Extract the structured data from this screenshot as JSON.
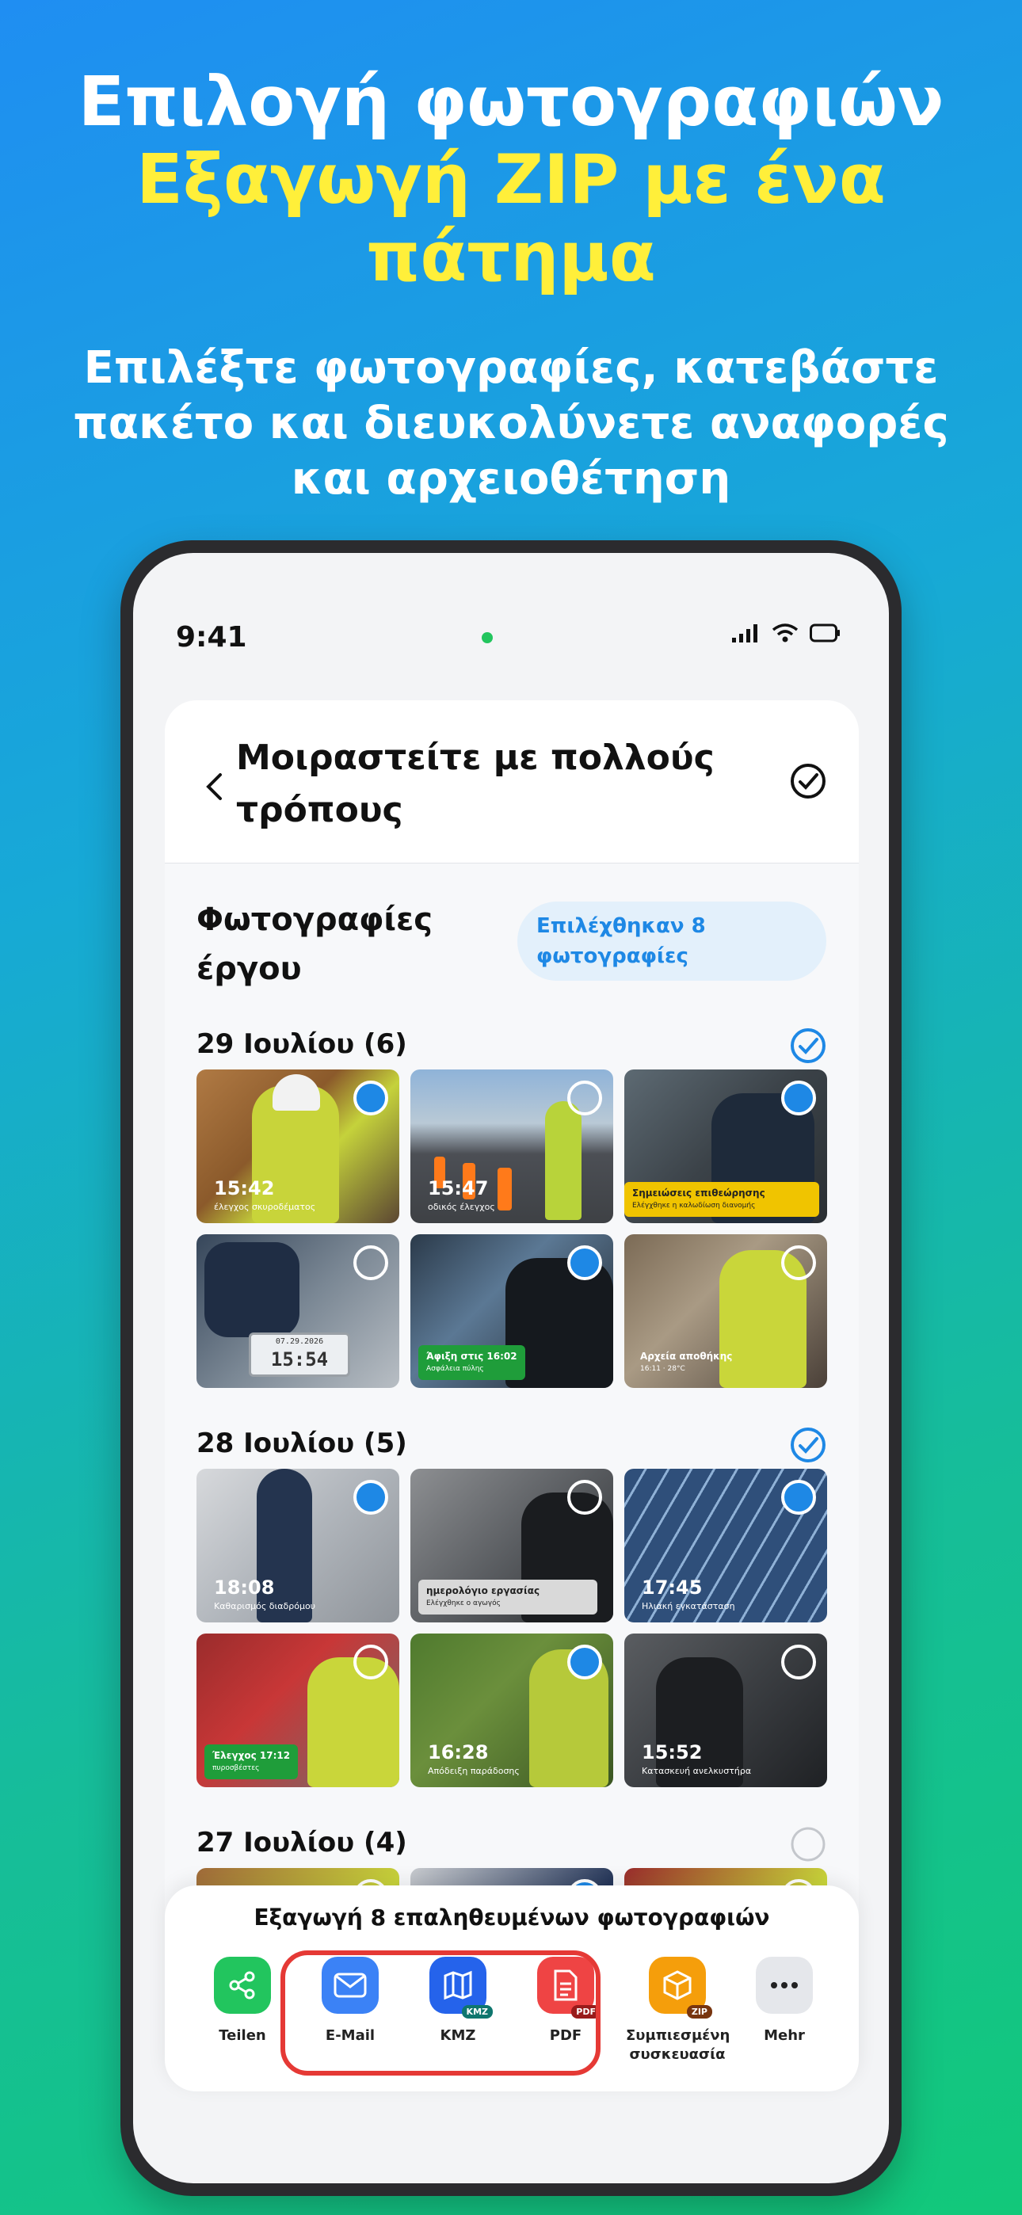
{
  "headline": {
    "line1": "Επιλογή φωτογραφιών",
    "line2": "Εξαγωγή ZIP με ένα",
    "line3": "πάτημα"
  },
  "subhead": {
    "line1": "Επιλέξτε φωτογραφίες, κατεβάστε",
    "line2": "πακέτο και διευκολύνετε αναφορές",
    "line3": "και αρχειοθέτηση"
  },
  "status_bar": {
    "time": "9:41"
  },
  "topbar": {
    "title": "Μοιραστείτε με πολλούς τρόπους"
  },
  "section": {
    "title": "Φωτογραφίες έργου",
    "selected_badge": "Επιλέχθηκαν 8 φωτογραφίες"
  },
  "groups": [
    {
      "date": "29 Ιουλίου (6)",
      "all_checked": true,
      "photos": [
        {
          "selected": true,
          "time": "15:42",
          "caption": "έλεγχος σκυροδέματος"
        },
        {
          "selected": false,
          "time": "15:47",
          "caption": "οδικός έλεγχος"
        },
        {
          "selected": true,
          "note_title": "Σημειώσεις επιθεώρησης",
          "note_sub": "Ελέγχθηκε η καλωδίωση διανομής"
        },
        {
          "selected": false,
          "clock_date": "07.29.2026",
          "clock_time": "15:54"
        },
        {
          "selected": true,
          "note_title": "Άφιξη στις 16:02",
          "note_sub": "Ασφάλεια πύλης"
        },
        {
          "selected": false,
          "note_title": "Αρχεία αποθήκης",
          "note_sub": "16:11 · 28°C"
        }
      ]
    },
    {
      "date": "28 Ιουλίου (5)",
      "all_checked": true,
      "photos": [
        {
          "selected": true,
          "time": "18:08",
          "caption": "Καθαρισμός διαδρόμου"
        },
        {
          "selected": false,
          "note_title": "ημερολόγιο εργασίας",
          "note_sub": "Ελέγχθηκε ο αγωγός"
        },
        {
          "selected": true,
          "time": "17:45",
          "caption": "Ηλιακή εγκατάσταση"
        },
        {
          "selected": false,
          "note_title": "Έλεγχος 17:12",
          "note_sub": "πυροσβέστες"
        },
        {
          "selected": true,
          "time": "16:28",
          "caption": "Απόδειξη παράδοσης"
        },
        {
          "selected": false,
          "time": "15:52",
          "caption": "Κατασκευή ανελκυστήρα"
        }
      ]
    },
    {
      "date": "27 Ιουλίου (4)",
      "all_checked": false
    }
  ],
  "export": {
    "title": "Εξαγωγή 8 επαληθευμένων φωτογραφιών",
    "buttons": [
      {
        "label": "Teilen",
        "color": "#22c55e"
      },
      {
        "label": "E-Mail",
        "color": "#3b82f6"
      },
      {
        "label": "KMZ",
        "tag": "KMZ",
        "color": "#2563eb"
      },
      {
        "label": "PDF",
        "tag": "PDF",
        "color": "#ef4444"
      },
      {
        "label": "Συμπιεσμένη συσκευασία",
        "tag": "ZIP",
        "color": "#f59e0b"
      },
      {
        "label": "Mehr",
        "color": "#e5e7eb"
      }
    ]
  },
  "colors": {
    "accent": "#1e88e5",
    "headline_yellow": "#ffef3a",
    "highlight_red": "#e53935"
  }
}
